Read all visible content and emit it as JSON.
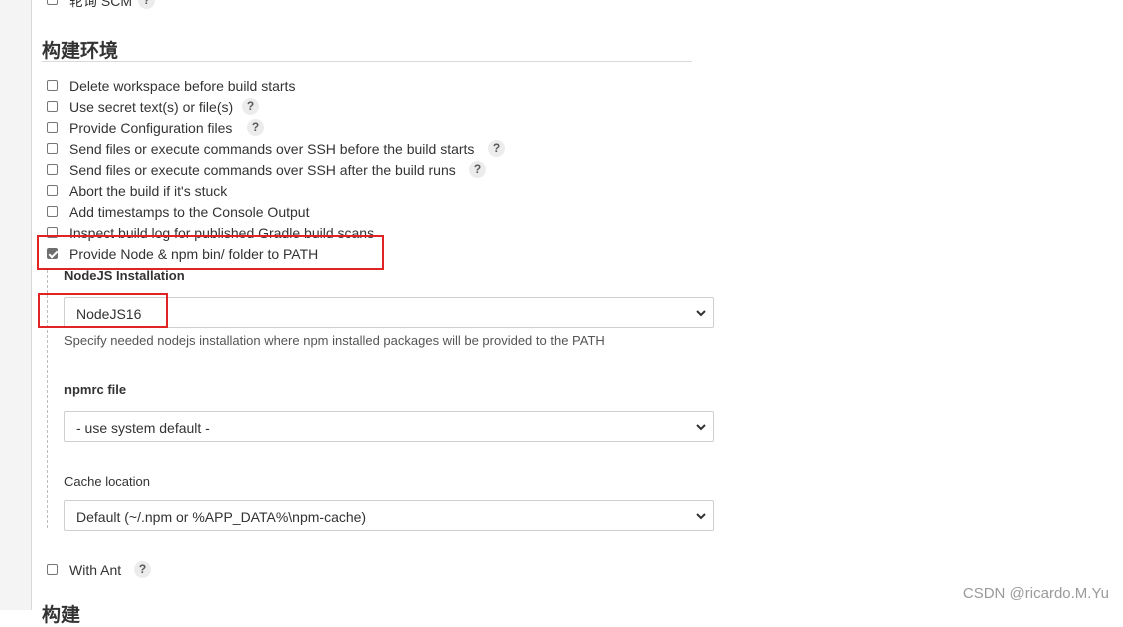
{
  "top_partial": {
    "label": "轮询 SCM",
    "help": "?"
  },
  "section": {
    "title": "构建环境"
  },
  "options": [
    {
      "label": "Delete workspace before build starts",
      "checked": false,
      "help": false
    },
    {
      "label": "Use secret text(s) or file(s)",
      "checked": false,
      "help": true
    },
    {
      "label": "Provide Configuration files",
      "checked": false,
      "help": true
    },
    {
      "label": "Send files or execute commands over SSH before the build starts",
      "checked": false,
      "help": true
    },
    {
      "label": "Send files or execute commands over SSH after the build runs",
      "checked": false,
      "help": true
    },
    {
      "label": "Abort the build if it's stuck",
      "checked": false,
      "help": false
    },
    {
      "label": "Add timestamps to the Console Output",
      "checked": false,
      "help": false
    },
    {
      "label": "Inspect build log for published Gradle build scans",
      "checked": false,
      "help": false
    },
    {
      "label": "Provide Node & npm bin/ folder to PATH",
      "checked": true,
      "help": false
    }
  ],
  "help_glyph": "?",
  "node": {
    "installation_label": "NodeJS Installation",
    "installation_value": "NodeJS16",
    "installation_desc": "Specify needed nodejs installation where npm installed packages will be provided to the PATH",
    "npmrc_label": "npmrc file",
    "npmrc_value": "- use system default -",
    "cache_label": "Cache location",
    "cache_value": "Default (~/.npm or %APP_DATA%\\npm-cache)"
  },
  "with_ant": {
    "label": "With Ant",
    "checked": false
  },
  "bottom_partial": {
    "label": "构建"
  },
  "watermark": "CSDN @ricardo.M.Yu",
  "colors": {
    "highlight_box": "#e02424",
    "help_bg": "#ececec"
  },
  "icons": [
    "help-icon",
    "chevron-down-icon",
    "checkbox-icon"
  ]
}
